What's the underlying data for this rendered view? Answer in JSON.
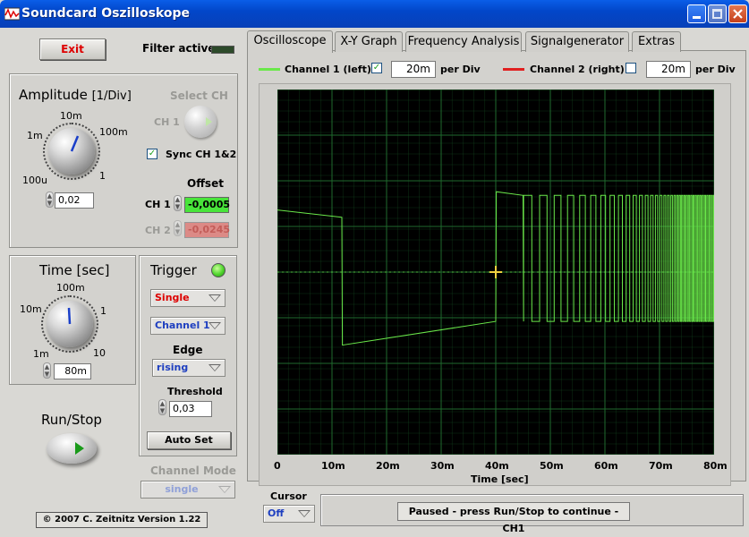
{
  "window": {
    "title": "Soundcard Oszilloskope"
  },
  "controls": {
    "exit_label": "Exit",
    "filter_label": "Filter active",
    "amplitude": {
      "title": "Amplitude",
      "unit": "[1/Div]",
      "scale_labels": [
        "100u",
        "1m",
        "10m",
        "100m",
        "1"
      ],
      "value": "0,02"
    },
    "select_ch": {
      "title": "Select CH",
      "value": "CH 1"
    },
    "sync_label": "Sync CH 1&2",
    "sync_checked": true,
    "offset": {
      "title": "Offset",
      "ch1_label": "CH 1",
      "ch1_value": "-0,0005",
      "ch2_label": "CH 2",
      "ch2_value": "-0,0245"
    },
    "time": {
      "title": "Time [sec]",
      "scale_labels": [
        "1m",
        "10m",
        "100m",
        "1",
        "10"
      ],
      "value": "80m"
    },
    "trigger": {
      "title": "Trigger",
      "mode": "Single",
      "channel": "Channel 1",
      "edge_label": "Edge",
      "edge": "rising",
      "threshold_label": "Threshold",
      "threshold": "0,03",
      "autoset_label": "Auto Set"
    },
    "run_stop_label": "Run/Stop",
    "channel_mode": {
      "title": "Channel Mode",
      "value": "single"
    },
    "copyright": "© 2007   C. Zeitnitz Version 1.22"
  },
  "tabs": [
    "Oscilloscope",
    "X-Y Graph",
    "Frequency Analysis",
    "Signalgenerator",
    "Extras"
  ],
  "active_tab": "Oscilloscope",
  "channels": {
    "ch1": {
      "label": "Channel 1 (left)",
      "enabled": true,
      "per_div": "20m",
      "per_div_label": "per Div",
      "color": "#6ae84a"
    },
    "ch2": {
      "label": "Channel 2 (right)",
      "enabled": false,
      "per_div": "20m",
      "per_div_label": "per Div",
      "color": "#e02020"
    }
  },
  "plot": {
    "xlabel": "Time [sec]",
    "x_ticks": [
      "0",
      "10m",
      "20m",
      "30m",
      "40m",
      "50m",
      "60m",
      "70m",
      "80m"
    ],
    "background": "#000000",
    "grid_color": "#1f6a2e"
  },
  "chart_data": {
    "type": "line",
    "xlabel": "Time [sec]",
    "x_unit": "s",
    "xlim": [
      0,
      0.08
    ],
    "ylim": [
      -0.1,
      0.1
    ],
    "grid": true,
    "series": [
      {
        "name": "Channel 1 (left)",
        "color": "#6ae84a",
        "x": [
          0,
          0.0118,
          0.0119,
          0.04,
          0.0401,
          0.045,
          0.0451
        ],
        "y": [
          0.034,
          0.03,
          -0.04,
          -0.027,
          0.044,
          0.042,
          -0.027
        ]
      }
    ]
  },
  "cursor": {
    "label": "Cursor",
    "value": "Off"
  },
  "status": "Paused - press Run/Stop to continue - CH1"
}
